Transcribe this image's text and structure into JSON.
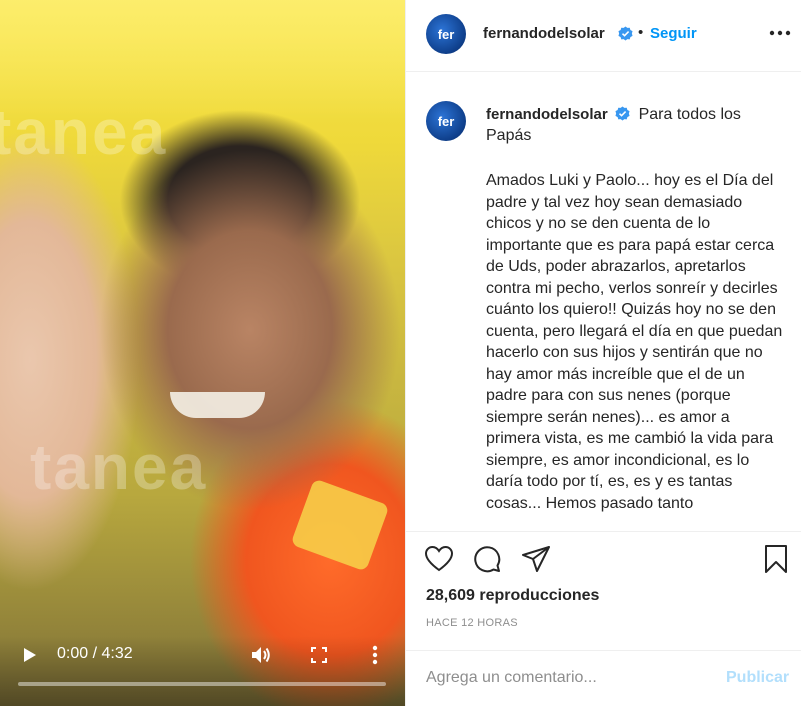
{
  "video": {
    "watermark": "tanea",
    "time_display": "0:00 / 4:32",
    "progress_fraction": 0.0,
    "icons": {
      "play": "play-icon",
      "volume": "volume-icon",
      "fullscreen": "fullscreen-icon",
      "more": "more-vertical-icon"
    }
  },
  "header": {
    "avatar_text": "fer",
    "username": "fernandodelsolar",
    "separator": "•",
    "follow_label": "Seguir",
    "verified_icon": "verified-badge-icon",
    "more_icon": "more-horizontal-icon"
  },
  "caption": {
    "avatar_text": "fer",
    "username": "fernandodelsolar",
    "title": "Para todos los Papás",
    "body": "Amados Luki y Paolo... hoy es el Día del padre y tal vez hoy sean demasiado chicos y no se den cuenta de lo importante que es para papá estar cerca de Uds, poder abrazarlos, apretarlos contra mi pecho, verlos sonreír y decirles cuánto los quiero!! Quizás hoy no se den cuenta, pero llegará el día en que puedan hacerlo con sus hijos y sentirán que no hay amor más increíble que el de un padre para con sus nenes (porque siempre serán nenes)... es amor a primera vista, es me cambió la vida para siempre, es amor incondicional, es lo daría todo por tí, es, es y es tantas cosas... Hemos pasado tanto"
  },
  "actions": {
    "icons": [
      "heart-icon",
      "comment-icon",
      "share-icon",
      "bookmark-icon"
    ],
    "views": "28,609 reproducciones",
    "time_ago": "HACE 12 HORAS"
  },
  "comment_box": {
    "placeholder": "Agrega un comentario...",
    "value": "",
    "publish_label": "Publicar"
  },
  "colors": {
    "accent": "#0095f6",
    "publish_disabled": "#b2dffc",
    "border": "#efefef",
    "muted": "#8e8e8e"
  }
}
